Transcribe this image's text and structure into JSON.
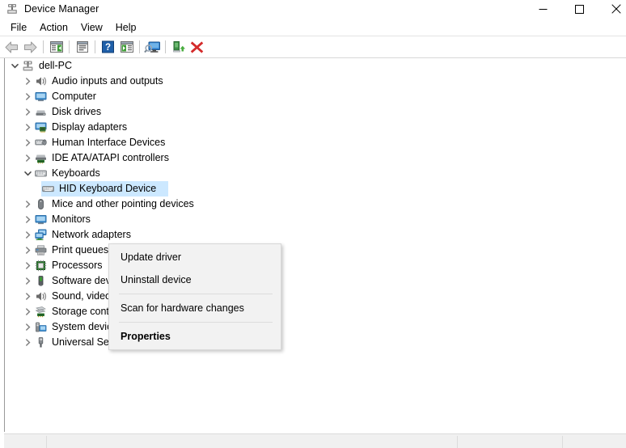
{
  "window": {
    "title": "Device Manager",
    "icon": "device-manager-icon",
    "controls": {
      "minimize": "minimize-icon",
      "maximize": "maximize-icon",
      "close": "close-icon"
    }
  },
  "menubar": {
    "items": [
      {
        "label": "File"
      },
      {
        "label": "Action"
      },
      {
        "label": "View"
      },
      {
        "label": "Help"
      }
    ]
  },
  "toolbar": {
    "buttons": [
      {
        "name": "back-button",
        "icon": "back-arrow-icon"
      },
      {
        "name": "forward-button",
        "icon": "forward-arrow-icon"
      },
      {
        "name": "show-hide-console-tree-button",
        "icon": "console-tree-icon"
      },
      {
        "name": "properties-button",
        "icon": "properties-window-icon"
      },
      {
        "name": "help-button",
        "icon": "question-mark-icon"
      },
      {
        "name": "show-hide-action-pane-button",
        "icon": "action-pane-icon"
      },
      {
        "name": "scan-for-hardware-changes-button",
        "icon": "scan-monitor-icon"
      },
      {
        "name": "update-driver-button",
        "icon": "update-driver-icon"
      },
      {
        "name": "uninstall-device-button",
        "icon": "red-x-icon"
      }
    ]
  },
  "tree": {
    "nodes": [
      {
        "label": "dell-PC",
        "depth": 0,
        "state": "expanded",
        "icon": "computer-root-icon",
        "selected": false
      },
      {
        "label": "Audio inputs and outputs",
        "depth": 1,
        "state": "collapsed",
        "icon": "speaker-icon",
        "selected": false
      },
      {
        "label": "Computer",
        "depth": 1,
        "state": "collapsed",
        "icon": "monitor-icon",
        "selected": false
      },
      {
        "label": "Disk drives",
        "depth": 1,
        "state": "collapsed",
        "icon": "disk-drive-icon",
        "selected": false
      },
      {
        "label": "Display adapters",
        "depth": 1,
        "state": "collapsed",
        "icon": "display-adapter-icon",
        "selected": false
      },
      {
        "label": "Human Interface Devices",
        "depth": 1,
        "state": "collapsed",
        "icon": "hid-icon",
        "selected": false
      },
      {
        "label": "IDE ATA/ATAPI controllers",
        "depth": 1,
        "state": "collapsed",
        "icon": "ide-controller-icon",
        "selected": false
      },
      {
        "label": "Keyboards",
        "depth": 1,
        "state": "expanded",
        "icon": "keyboard-icon",
        "selected": false
      },
      {
        "label": "HID Keyboard Device",
        "depth": 2,
        "state": "leaf",
        "icon": "keyboard-device-icon",
        "selected": true
      },
      {
        "label": "Mice and other pointing devices",
        "depth": 1,
        "state": "collapsed",
        "icon": "mouse-icon",
        "selected": false
      },
      {
        "label": "Monitors",
        "depth": 1,
        "state": "collapsed",
        "icon": "monitor-icon",
        "selected": false
      },
      {
        "label": "Network adapters",
        "depth": 1,
        "state": "collapsed",
        "icon": "network-adapter-icon",
        "selected": false
      },
      {
        "label": "Print queues",
        "depth": 1,
        "state": "collapsed",
        "icon": "printer-icon",
        "selected": false
      },
      {
        "label": "Processors",
        "depth": 1,
        "state": "collapsed",
        "icon": "processor-icon",
        "selected": false
      },
      {
        "label": "Software devices",
        "depth": 1,
        "state": "collapsed",
        "icon": "software-device-icon",
        "selected": false
      },
      {
        "label": "Sound, video and game controllers",
        "depth": 1,
        "state": "collapsed",
        "icon": "speaker-icon",
        "selected": false
      },
      {
        "label": "Storage controllers",
        "depth": 1,
        "state": "collapsed",
        "icon": "storage-controller-icon",
        "selected": false
      },
      {
        "label": "System devices",
        "depth": 1,
        "state": "collapsed",
        "icon": "system-device-icon",
        "selected": false
      },
      {
        "label": "Universal Serial Bus controllers",
        "depth": 1,
        "state": "collapsed",
        "icon": "usb-icon",
        "selected": false
      }
    ]
  },
  "context_menu": {
    "items": [
      {
        "label": "Update driver",
        "type": "item",
        "bold": false
      },
      {
        "label": "Uninstall device",
        "type": "item",
        "bold": false
      },
      {
        "type": "separator"
      },
      {
        "label": "Scan for hardware changes",
        "type": "item",
        "bold": false
      },
      {
        "type": "separator"
      },
      {
        "label": "Properties",
        "type": "item",
        "bold": true
      }
    ]
  },
  "statusbar": {
    "panels": [
      "",
      "",
      ""
    ]
  },
  "colors": {
    "selection": "#cce8ff",
    "menu_bg": "#f2f2f2",
    "statusbar_bg": "#f0f0f0",
    "accent_red": "#d42b2b",
    "accent_blue": "#1f5fa9",
    "accent_green": "#3d9b35"
  }
}
